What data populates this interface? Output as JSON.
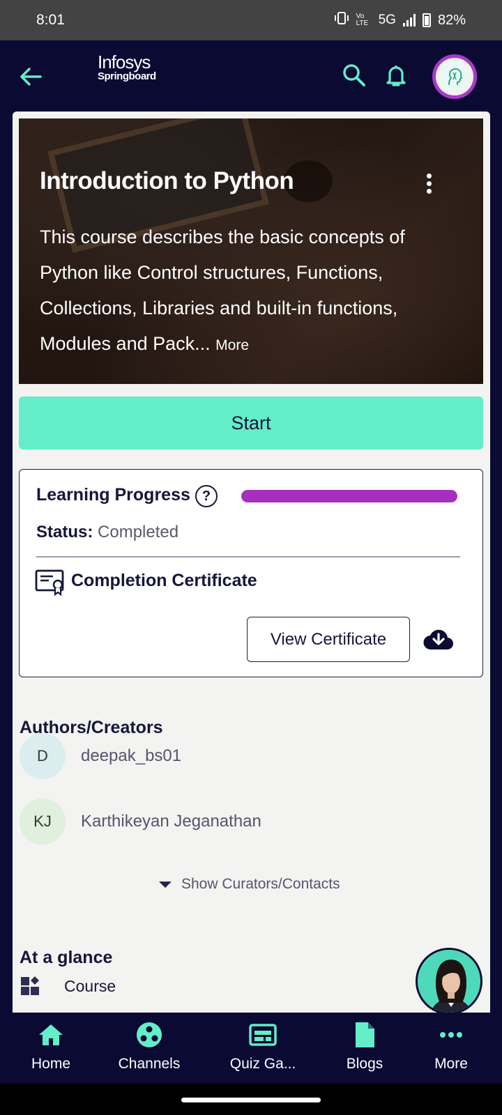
{
  "status_bar": {
    "time": "8:01",
    "network": "5G",
    "volte": "Vo LTE",
    "battery": "82%"
  },
  "header": {
    "logo_line1": "Infosys",
    "logo_line2": "Springboard",
    "icons": [
      "back-arrow-icon",
      "search-icon",
      "bell-icon",
      "avatar"
    ]
  },
  "course": {
    "title": "Introduction to Python",
    "description": "This course describes the basic concepts of Python like Control structures, Functions, Collections, Libraries and built-in functions, Modules and Pack...",
    "more_label": "More"
  },
  "start_label": "Start",
  "progress": {
    "label": "Learning Progress",
    "help_glyph": "?",
    "percent": 100,
    "status_key": "Status:",
    "status_value": "Completed",
    "certificate_label": "Completion Certificate",
    "view_certificate_label": "View Certificate"
  },
  "authors": {
    "title": "Authors/Creators",
    "list": [
      {
        "initials": "D",
        "name": "deepak_bs01",
        "color": "#dcedf0"
      },
      {
        "initials": "KJ",
        "name": "Karthikeyan Jeganathan",
        "color": "#dff0dc"
      }
    ],
    "show_curators_label": "Show Curators/Contacts"
  },
  "glance": {
    "title": "At a glance",
    "item_label": "Course"
  },
  "bottom_nav": [
    {
      "label": "Home",
      "icon": "home-icon"
    },
    {
      "label": "Channels",
      "icon": "channels-icon"
    },
    {
      "label": "Quiz Ga...",
      "icon": "quiz-icon"
    },
    {
      "label": "Blogs",
      "icon": "blogs-icon"
    },
    {
      "label": "More",
      "icon": "more-icon"
    }
  ],
  "colors": {
    "accent": "#63edc8",
    "navy": "#0b0a33",
    "progress": "#a72fbf"
  }
}
